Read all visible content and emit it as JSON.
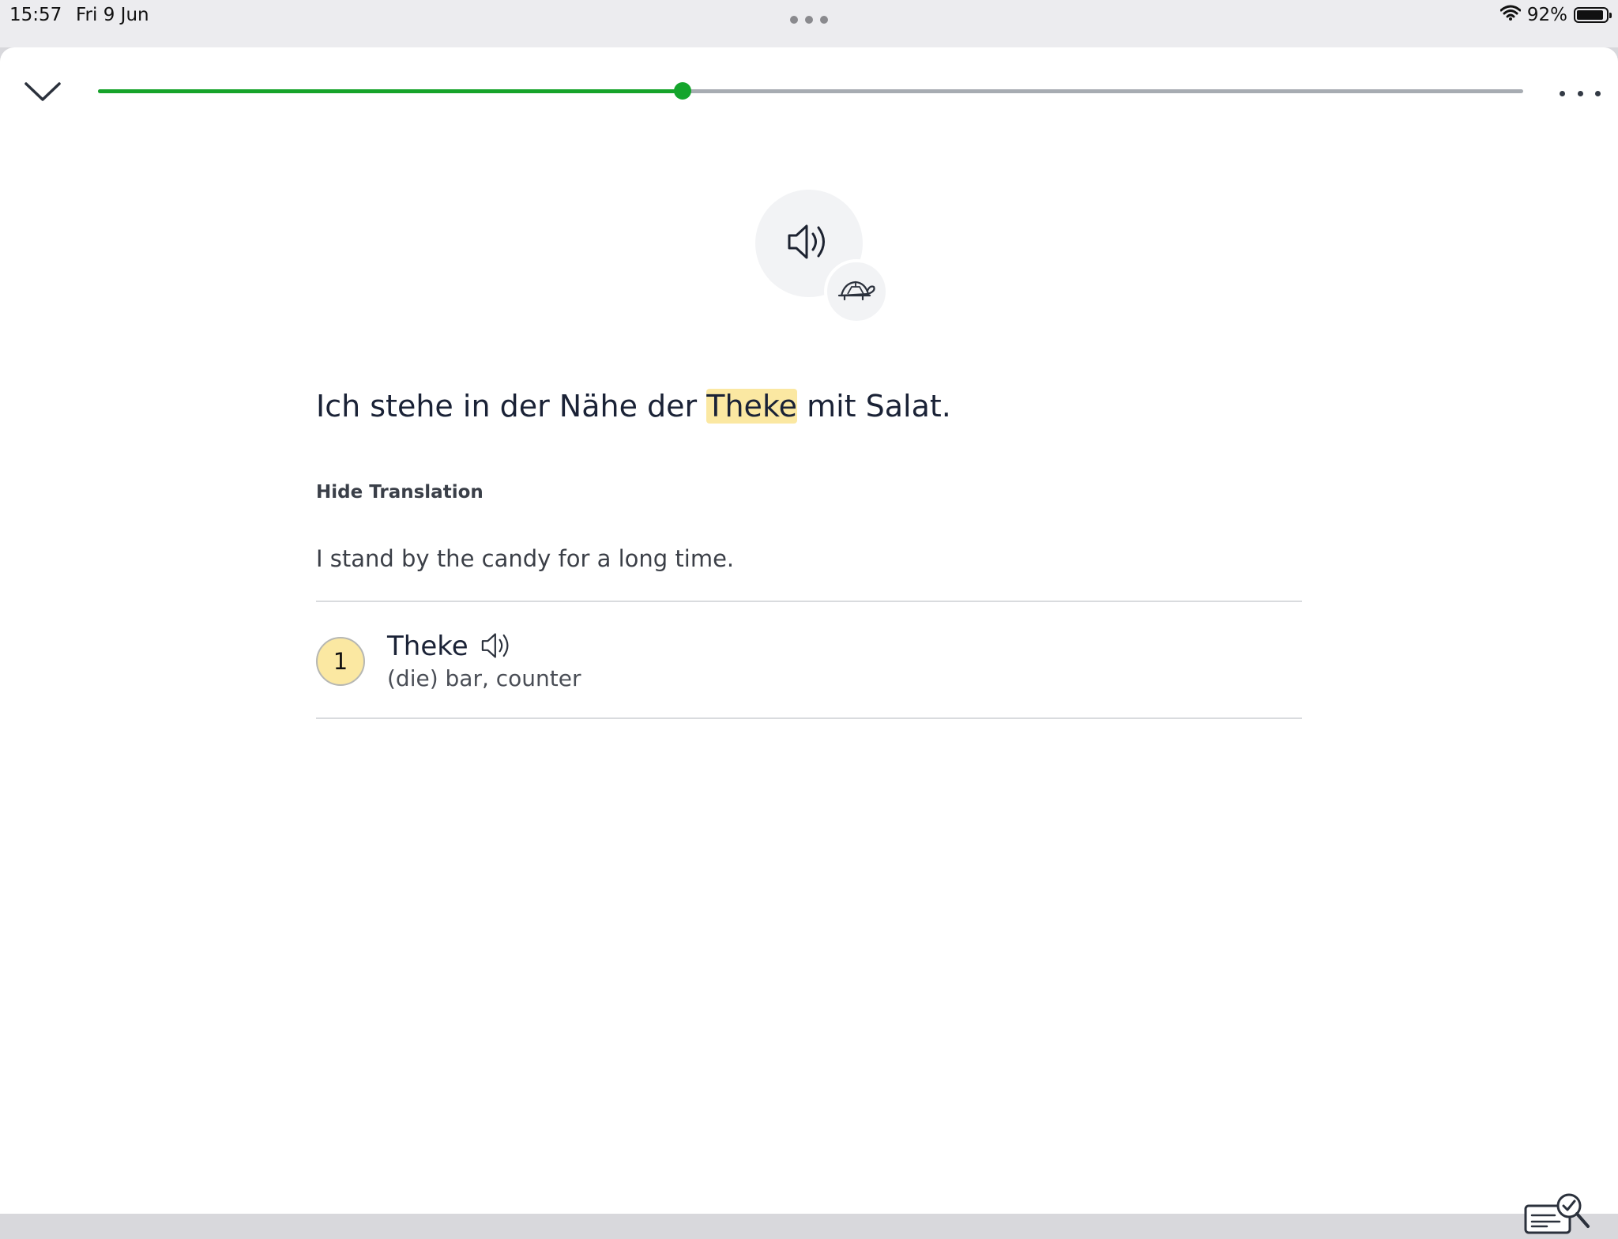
{
  "status_bar": {
    "time": "15:57",
    "date": "Fri 9 Jun",
    "battery_text": "92%",
    "battery_level": 0.92
  },
  "header": {
    "progress_fraction": 0.41,
    "progress_color": "#16a32a",
    "icons": [
      "chevron-down-icon",
      "more-horizontal-icon"
    ]
  },
  "audio": {
    "icons": [
      "speaker-icon",
      "turtle-icon"
    ]
  },
  "sentence": {
    "before": "Ich stehe in der Nähe der ",
    "highlighted": "Theke",
    "after": " mit Salat."
  },
  "translation": {
    "toggle_label": "Hide Translation",
    "text": "I stand by the candy for a long time."
  },
  "words": [
    {
      "number": "1",
      "term": "Theke",
      "definition": "(die) bar, counter"
    }
  ],
  "footer": {
    "icons": [
      "review-check-icon"
    ]
  },
  "colors": {
    "highlight": "#fbe8a2",
    "text": "#1a2236"
  }
}
